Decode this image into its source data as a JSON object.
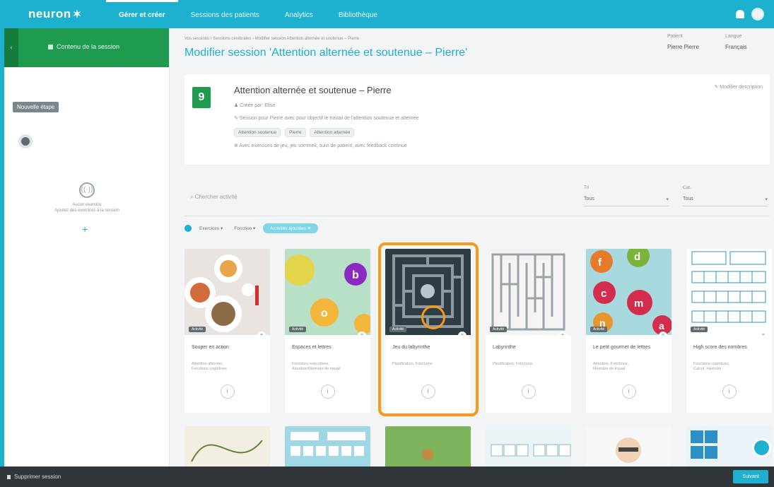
{
  "app": {
    "logo": "neuron",
    "logo_mark": "✶"
  },
  "nav": [
    {
      "label": "Gérer et créer"
    },
    {
      "label": "Sessions des patients"
    },
    {
      "label": "Analytics"
    },
    {
      "label": "Bibliothèque"
    }
  ],
  "sidebar": {
    "header_title": "Contenu de la session",
    "collapse_icon": "‹",
    "badge": "Nouvelle étape",
    "empty_icon": "((·))",
    "empty_text": "Aucun exercice\nAjoutez des exercices à la session",
    "add_symbol": "+"
  },
  "header": {
    "breadcrumb": "Vos sessions  ›  Sessions cérébrales  ›  Modifier session Attention alternée et soutenue – Pierre",
    "title": "Modifier session 'Attention alternée et soutenue – Pierre'",
    "field1_label": "Patient",
    "field1_value": "Pierre Pierre",
    "field2_label": "Langue",
    "field2_value": "Français"
  },
  "session": {
    "icon_letter": "9",
    "title": "Attention alternée et soutenue – Pierre",
    "author": "♟ Créée par: Elise",
    "description": "✎ Session pour Pierre avec pour objectif le travail de l'attention soutenue et alternée",
    "tags": [
      "Attention soutenue",
      "Pierre",
      "Attention alternée"
    ],
    "note": "⊕ Avec exercices de jeu, jeu sommeil, suivi de patient, avec feedback continue",
    "link": "✎ Modifier description"
  },
  "filters": {
    "search_placeholder": "⌕ Chercher activité",
    "select1_label": "Tri",
    "select1_value": "Tous",
    "select2_label": "Cat.",
    "select2_value": "Tous",
    "caret": "▾",
    "chips": [
      "Exercices ▾",
      "Fonction ▾",
      "Activités ajoutées ✕"
    ]
  },
  "exercises": [
    {
      "title": "Souper en action",
      "desc": "Attention alternée,\nFonctions cognitives",
      "tag": "Activité"
    },
    {
      "title": "Espaces et lettres",
      "desc": "Fonctions exécutives,\nAttention/Mémoire de travail",
      "tag": "Activité"
    },
    {
      "title": "Jeu du labyrinthe",
      "desc": "Planification, Fonctions",
      "tag": "Activité"
    },
    {
      "title": "Labyrinthe",
      "desc": "Planification, Fonctions",
      "tag": "Activité"
    },
    {
      "title": "Le petit gourmet de lettres",
      "desc": "Attention, Fonctions,\nMémoire de travail",
      "tag": "Activité"
    },
    {
      "title": "High score des nombres",
      "desc": "Fonctions cognitives,\nCalcul, mémoire",
      "tag": "Activité"
    }
  ],
  "info_symbol": "i",
  "fav_symbol": "♥",
  "bottom": {
    "delete": "Supprimer session",
    "next": "Suivant"
  },
  "colors": {
    "brand": "#1eb0cf",
    "green": "#1e9b4e",
    "highlight": "#f59a1b"
  }
}
